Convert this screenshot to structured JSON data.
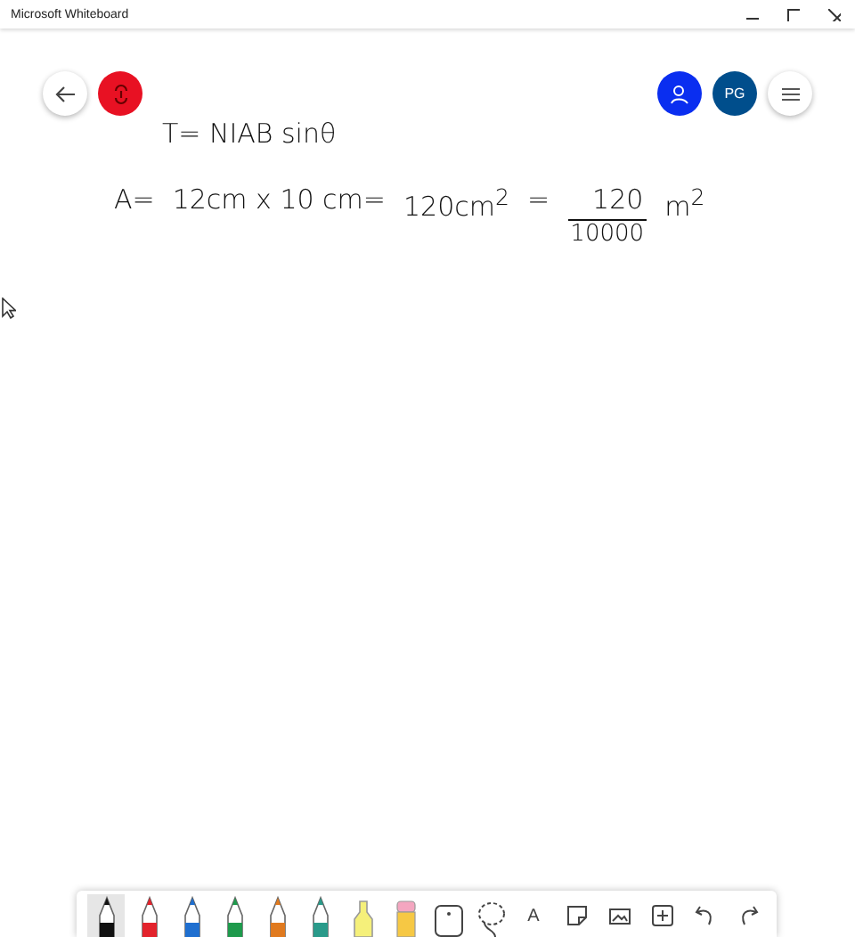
{
  "window": {
    "title": "Microsoft Whiteboard"
  },
  "top_left": [
    {
      "kind": "back"
    },
    {
      "kind": "share"
    }
  ],
  "top_right": [
    {
      "kind": "user"
    },
    {
      "kind": "initials",
      "label": "PG"
    },
    {
      "kind": "menu"
    }
  ],
  "ink": {
    "line_1": "T= NIAB sinθ",
    "line_2": [
      "A=",
      "12cm x 10 cm=",
      "120cm$^{2}$",
      "="
    ],
    "fraction": {
      "numerator": "120",
      "denominator": "10000"
    },
    "unit": "m$^{2}$"
  },
  "toolbar": [
    {
      "kind": "pen",
      "color": "#111111",
      "selected": true
    },
    {
      "kind": "pen",
      "color": "#e3232c",
      "selected": false
    },
    {
      "kind": "pen",
      "color": "#1f6fd0",
      "selected": false
    },
    {
      "kind": "pen",
      "color": "#1e9a4c",
      "selected": false
    },
    {
      "kind": "pen",
      "color": "#e07a1f",
      "selected": false
    },
    {
      "kind": "pen",
      "color": "#2a9a8a",
      "selected": false
    },
    {
      "kind": "highlighter",
      "color": "#f5f07a",
      "selected": false
    },
    {
      "kind": "eraser",
      "selected": false
    },
    {
      "kind": "ruler",
      "selected": false
    },
    {
      "kind": "lasso",
      "selected": false
    },
    {
      "kind": "text",
      "label": "A",
      "selected": false
    },
    {
      "kind": "note",
      "selected": false
    },
    {
      "kind": "image",
      "selected": false
    },
    {
      "kind": "insert",
      "selected": false
    },
    {
      "kind": "undo",
      "selected": false
    },
    {
      "kind": "redo",
      "selected": false
    }
  ]
}
